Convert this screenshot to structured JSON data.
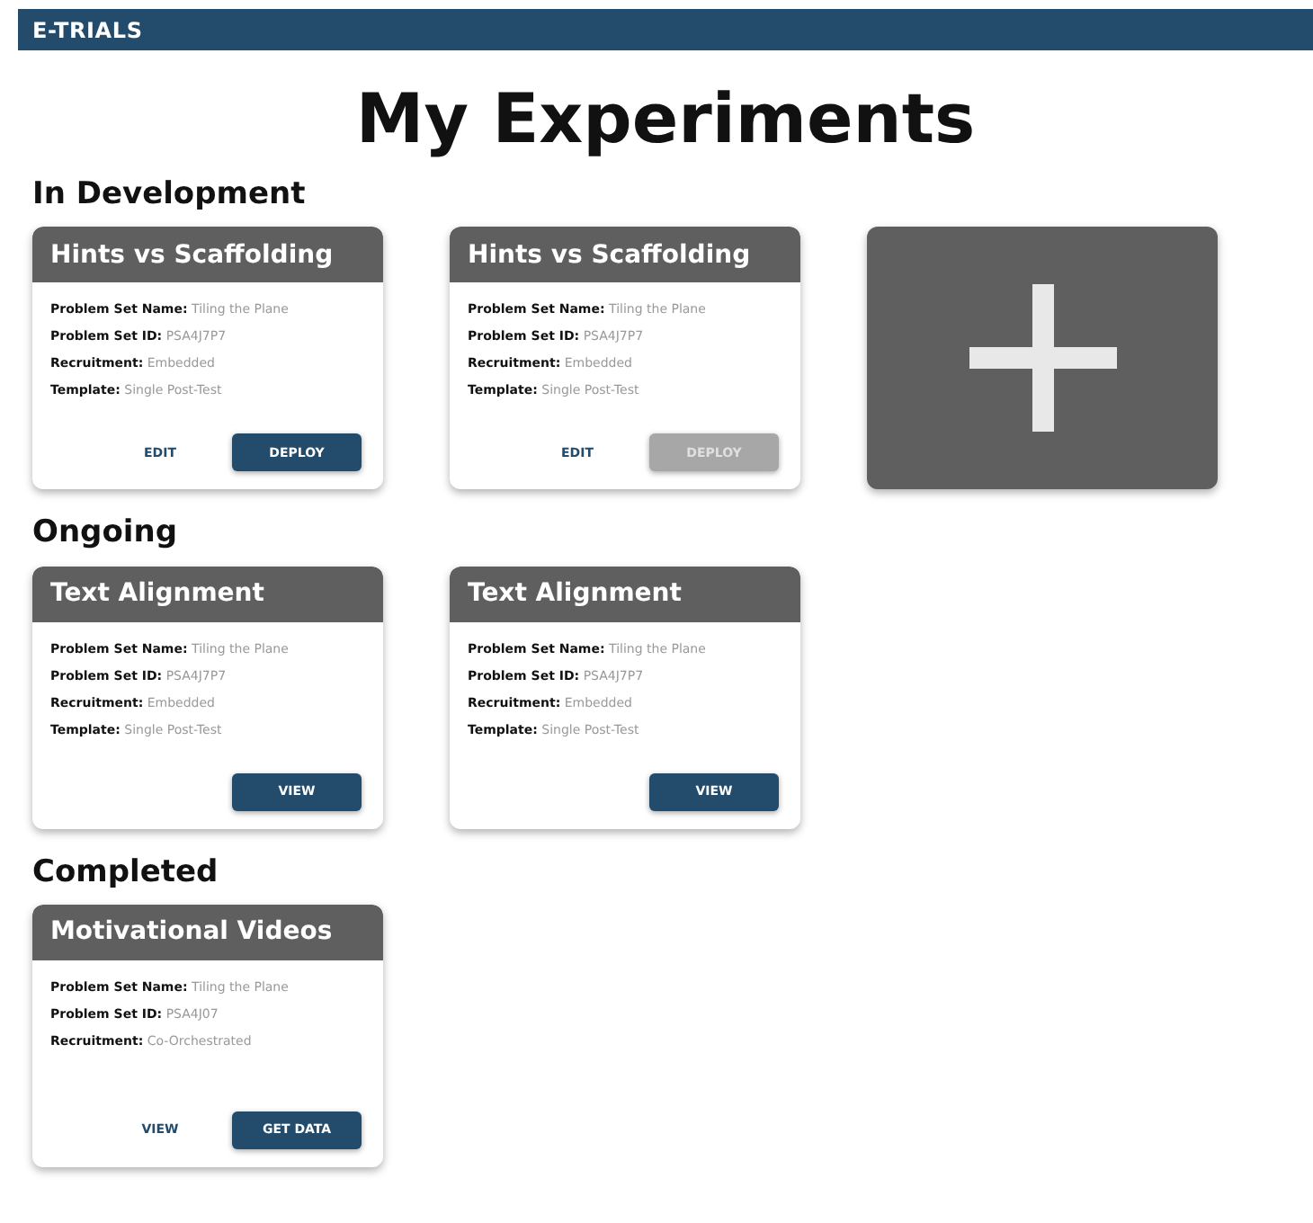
{
  "header": {
    "logo": "E-TRIALS"
  },
  "title": "My Experiments",
  "sections": [
    {
      "heading": "In Development",
      "add_tile": true,
      "cards": [
        {
          "title": "Hints vs Scaffolding",
          "fields": [
            {
              "label": "Problem Set Name:",
              "value": "Tiling the Plane"
            },
            {
              "label": "Problem Set ID:",
              "value": "PSA4J7P7"
            },
            {
              "label": "Recruitment:",
              "value": "Embedded"
            },
            {
              "label": "Template:",
              "value": "Single Post-Test"
            }
          ],
          "buttons": [
            {
              "label": "EDIT",
              "kind": "text",
              "disabled": false
            },
            {
              "label": "DEPLOY",
              "kind": "filled",
              "disabled": false
            }
          ]
        },
        {
          "title": "Hints vs Scaffolding",
          "fields": [
            {
              "label": "Problem Set Name:",
              "value": "Tiling the Plane"
            },
            {
              "label": "Problem Set ID:",
              "value": "PSA4J7P7"
            },
            {
              "label": "Recruitment:",
              "value": "Embedded"
            },
            {
              "label": "Template:",
              "value": "Single Post-Test"
            }
          ],
          "buttons": [
            {
              "label": "EDIT",
              "kind": "text",
              "disabled": false
            },
            {
              "label": "DEPLOY",
              "kind": "filled",
              "disabled": true
            }
          ]
        }
      ]
    },
    {
      "heading": "Ongoing",
      "cards": [
        {
          "title": "Text Alignment",
          "fields": [
            {
              "label": "Problem Set Name:",
              "value": "Tiling the Plane"
            },
            {
              "label": "Problem Set ID:",
              "value": "PSA4J7P7"
            },
            {
              "label": "Recruitment:",
              "value": "Embedded"
            },
            {
              "label": "Template:",
              "value": "Single Post-Test"
            }
          ],
          "buttons": [
            {
              "label": "VIEW",
              "kind": "filled",
              "disabled": false
            }
          ]
        },
        {
          "title": "Text Alignment",
          "fields": [
            {
              "label": "Problem Set Name:",
              "value": "Tiling the Plane"
            },
            {
              "label": "Problem Set ID:",
              "value": "PSA4J7P7"
            },
            {
              "label": "Recruitment:",
              "value": "Embedded"
            },
            {
              "label": "Template:",
              "value": "Single Post-Test"
            }
          ],
          "buttons": [
            {
              "label": "VIEW",
              "kind": "filled",
              "disabled": false
            }
          ]
        }
      ]
    },
    {
      "heading": "Completed",
      "cards": [
        {
          "title": "Motivational Videos",
          "fields": [
            {
              "label": "Problem Set Name:",
              "value": "Tiling the Plane"
            },
            {
              "label": "Problem Set ID:",
              "value": "PSA4J07"
            },
            {
              "label": "Recruitment:",
              "value": "Co-Orchestrated"
            }
          ],
          "buttons": [
            {
              "label": "VIEW",
              "kind": "text",
              "disabled": false
            },
            {
              "label": "GET DATA",
              "kind": "filled",
              "disabled": false
            }
          ]
        }
      ]
    }
  ]
}
